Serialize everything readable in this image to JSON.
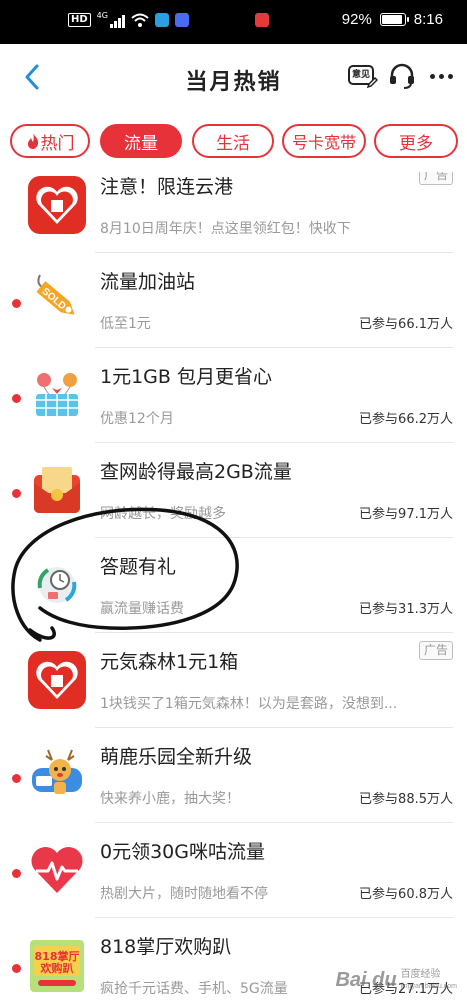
{
  "status_bar": {
    "left_badge": "HD",
    "network": "4G",
    "battery": "92%",
    "battery_level": 0.92,
    "time": "8:16"
  },
  "header": {
    "title": "当月热销",
    "feedback_label": "意见"
  },
  "tabs": [
    {
      "label": "热门",
      "active": false,
      "icon": "fire-icon"
    },
    {
      "label": "流量",
      "active": true
    },
    {
      "label": "生活",
      "active": false
    },
    {
      "label": "号卡宽带",
      "active": false
    },
    {
      "label": "更多",
      "active": false
    }
  ],
  "items": [
    {
      "title": "注意！限连云港",
      "subtitle": "8月10日周年庆！点这里领红包！快收下",
      "count": "",
      "ad": "广告",
      "dot": false,
      "icon": "pinduoduo-icon"
    },
    {
      "title": "流量加油站",
      "subtitle": "低至1元",
      "count": "已参与66.1万人",
      "ad": "",
      "dot": true,
      "icon": "sold-tag-icon"
    },
    {
      "title": "1元1GB  包月更省心",
      "subtitle": "优惠12个月",
      "count": "已参与66.2万人",
      "ad": "",
      "dot": true,
      "icon": "gift-basket-icon"
    },
    {
      "title": "查网龄得最高2GB流量",
      "subtitle": "网龄越长，奖励越多",
      "count": "已参与97.1万人",
      "ad": "",
      "dot": true,
      "icon": "red-envelope-icon"
    },
    {
      "title": "答题有礼",
      "subtitle": "赢流量赚话费",
      "count": "已参与31.3万人",
      "ad": "",
      "dot": false,
      "icon": "quiz-clock-icon"
    },
    {
      "title": "元気森林1元1箱",
      "subtitle": "1块钱买了1箱元気森林！以为是套路，没想到...",
      "count": "",
      "ad": "广告",
      "dot": false,
      "icon": "pinduoduo-icon"
    },
    {
      "title": "萌鹿乐园全新升级",
      "subtitle": "快来养小鹿，抽大奖！",
      "count": "已参与88.5万人",
      "ad": "",
      "dot": true,
      "icon": "deer-icon"
    },
    {
      "title": "0元领30G咪咕流量",
      "subtitle": "热剧大片，随时随地看不停",
      "count": "已参与60.8万人",
      "ad": "",
      "dot": true,
      "icon": "heart-pulse-icon"
    },
    {
      "title": "818掌厅欢购趴",
      "subtitle": "疯抢千元话费、手机、5G流量",
      "count": "已参与27.1万人",
      "ad": "",
      "dot": true,
      "icon": "party-818-icon"
    }
  ],
  "watermark": {
    "logo": "Bai du",
    "line1": "百度经验",
    "line2": "jingyan.baidu.com"
  },
  "colors": {
    "accent": "#e8323a",
    "text": "#222222",
    "muted": "#9a9a9a"
  }
}
